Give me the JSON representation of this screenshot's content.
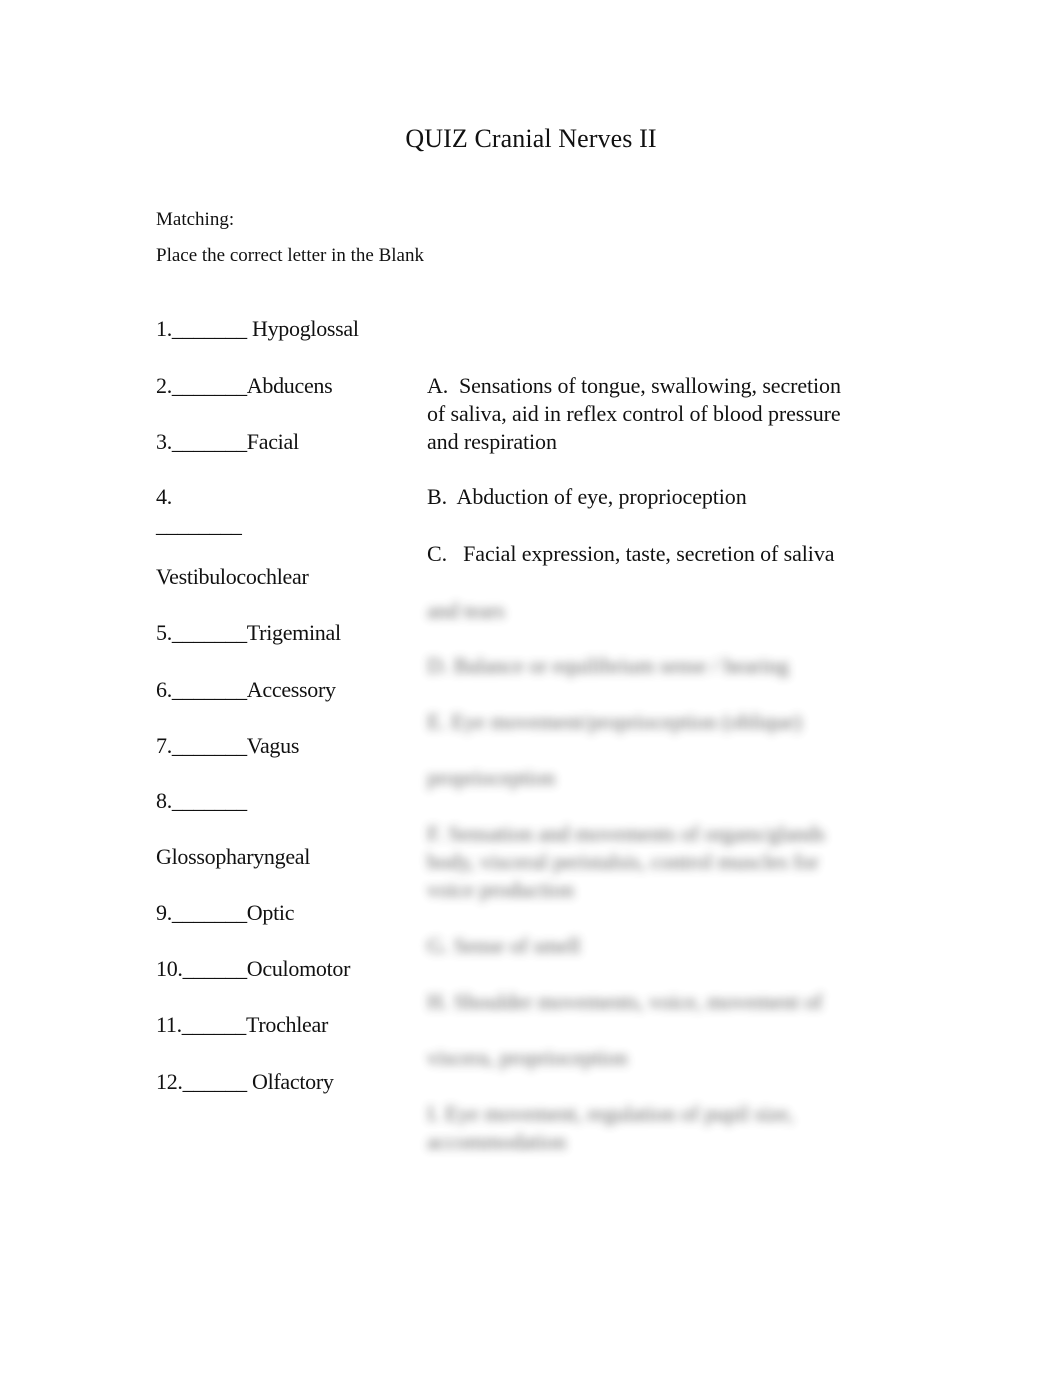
{
  "document": {
    "title": "QUIZ Cranial Nerves II",
    "section_label": "Matching:",
    "instruction": "Place the correct letter in the Blank"
  },
  "left_items": [
    {
      "lines": [
        "1._______ Hypoglossal"
      ]
    },
    {
      "lines": [
        "2._______Abducens"
      ]
    },
    {
      "lines": [
        "3._______Facial"
      ]
    },
    {
      "lines": [
        "4.",
        "________",
        "Vestibulocochlear"
      ]
    },
    {
      "lines": [
        "5._______Trigeminal"
      ]
    },
    {
      "lines": [
        "6._______Accessory"
      ]
    },
    {
      "lines": [
        "7._______Vagus"
      ]
    },
    {
      "lines": [
        "8._______",
        "Glossopharyngeal"
      ]
    },
    {
      "lines": [
        "9._______Optic"
      ]
    },
    {
      "lines": [
        "10.______Oculomotor"
      ]
    },
    {
      "lines": [
        "11.______Trochlear"
      ]
    },
    {
      "lines": [
        "12.______ Olfactory"
      ]
    }
  ],
  "right_items": [
    {
      "lines": [
        "A.  Sensations of tongue, swallowing, secretion",
        "of saliva, aid in reflex control of blood pressure",
        "and respiration"
      ],
      "obscured": false
    },
    {
      "lines": [
        "B.  Abduction of eye, proprioception"
      ],
      "obscured": false
    },
    {
      "lines": [
        "C.   Facial expression, taste, secretion of saliva"
      ],
      "obscured": false
    }
  ],
  "obscured_region": {
    "note": "Remaining answer choices are blurred / not legible in the image",
    "placeholder_lines": [
      "and tears",
      "D. Balance or equilibrium sense / hearing",
      "E.  Eye movement/proprioception (oblique)",
      "proprioception",
      "F.  Sensation and movements of organs/glands",
      "body, visceral peristalsis, control muscles for",
      "voice production",
      "G.  Sense of smell",
      "H.  Shoulder movements, voice, movement of",
      "viscera, proprioception",
      "I.   Eye movement, regulation of pupil size,",
      "accommodation"
    ]
  }
}
